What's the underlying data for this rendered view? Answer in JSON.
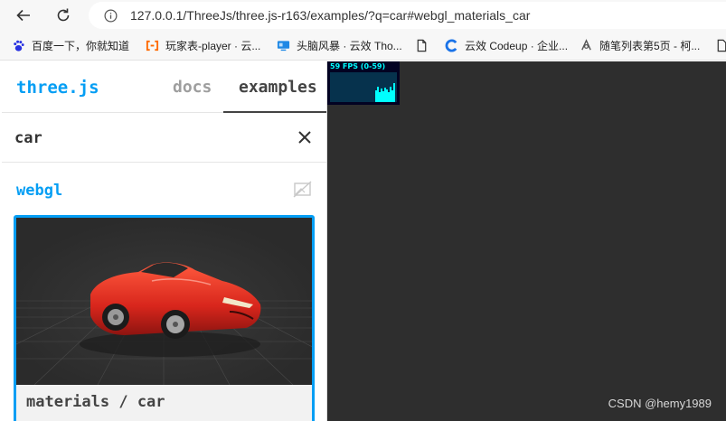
{
  "browser": {
    "url": "127.0.0.1/ThreeJs/three.js-r163/examples/?q=car#webgl_materials_car",
    "bookmarks": [
      {
        "label": "百度一下，你就知道",
        "icon": "baidu-paw-icon",
        "color": "#2932e1"
      },
      {
        "label": "玩家表-player · 云...",
        "icon": "aliyun-bracket-icon",
        "color": "#ff6a00"
      },
      {
        "label": "头脑风暴 · 云效 Tho...",
        "icon": "monitor-icon",
        "color": "#1e88e5"
      },
      {
        "label": "",
        "icon": "document-icon",
        "color": "#333333"
      },
      {
        "label": "云效 Codeup · 企业...",
        "icon": "codeup-c-icon",
        "color": "#1a73e8"
      },
      {
        "label": "随笔列表第5页 - 柯...",
        "icon": "cnblogs-icon",
        "color": "#555555"
      },
      {
        "label": "",
        "icon": "document-icon",
        "color": "#333333"
      }
    ]
  },
  "sidebar": {
    "brand": "three.js",
    "tabs": [
      {
        "label": "docs",
        "active": false
      },
      {
        "label": "examples",
        "active": true
      }
    ],
    "search": {
      "value": "car"
    },
    "category": "webgl",
    "example": {
      "label": "materials / car"
    }
  },
  "viewport": {
    "stats_text": "59 FPS (0-59)",
    "watermark": "CSDN @hemy1989"
  },
  "colors": {
    "accent": "#049ef4",
    "viewport_bg": "#2e2e2e",
    "stats_bg": "#020222",
    "stats_fg": "#00ffff",
    "car": "#d8261c"
  }
}
